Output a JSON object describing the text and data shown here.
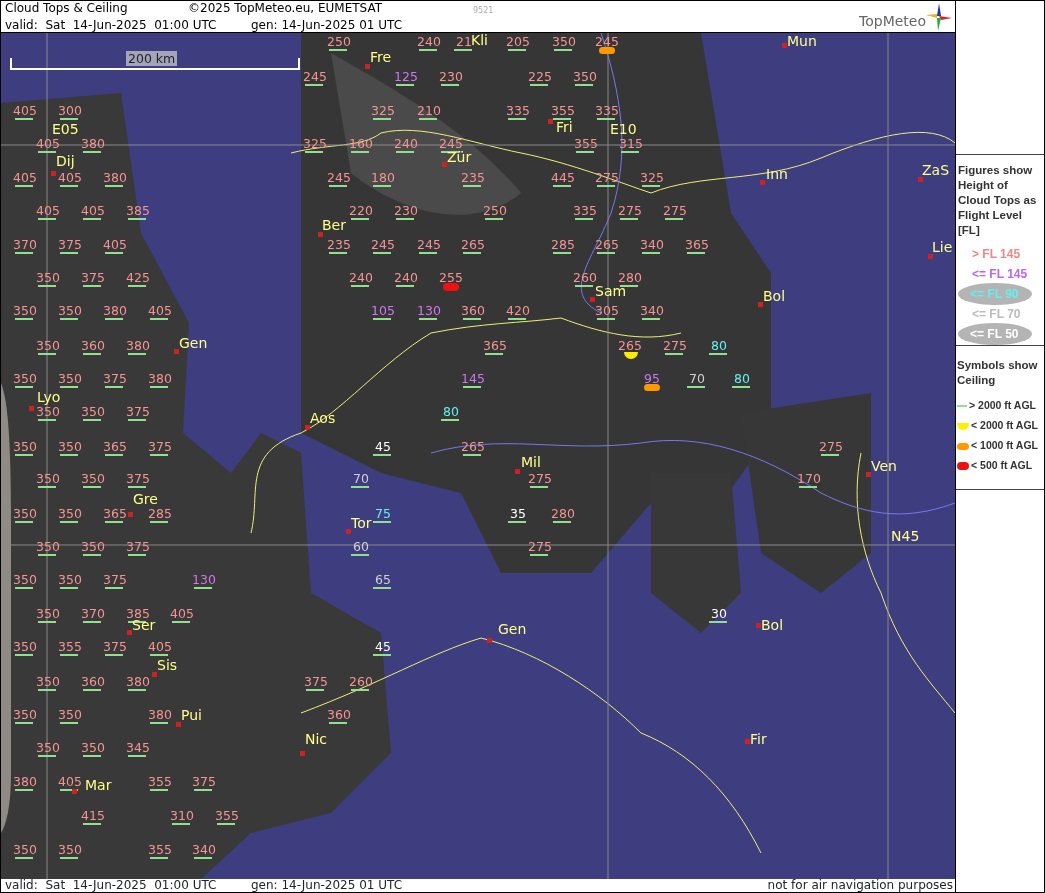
{
  "header": {
    "title": "Cloud Tops & Ceiling",
    "copyright": "©2025 TopMeteo.eu, EUMETSAT",
    "code": "9521",
    "valid": "valid:  Sat  14-Jun-2025  01:00 UTC",
    "generated": "gen: 14-Jun-2025 01 UTC",
    "logo": "TopMeteo"
  },
  "map": {
    "scale_bar": "200 km",
    "places": [
      {
        "name": "Kli",
        "kind": "label"
      },
      {
        "name": "Mun",
        "kind": "city"
      },
      {
        "name": "Fre",
        "kind": "city"
      },
      {
        "name": "E05",
        "kind": "label"
      },
      {
        "name": "Fri",
        "kind": "city"
      },
      {
        "name": "E10",
        "kind": "label"
      },
      {
        "name": "Dij",
        "kind": "city"
      },
      {
        "name": "Zür",
        "kind": "city"
      },
      {
        "name": "Inn",
        "kind": "city"
      },
      {
        "name": "ZaS",
        "kind": "city"
      },
      {
        "name": "Ber",
        "kind": "city"
      },
      {
        "name": "Lie",
        "kind": "city"
      },
      {
        "name": "Sam",
        "kind": "city"
      },
      {
        "name": "Bol",
        "kind": "city"
      },
      {
        "name": "Gen",
        "kind": "city"
      },
      {
        "name": "Lyo",
        "kind": "city"
      },
      {
        "name": "Aos",
        "kind": "city"
      },
      {
        "name": "Mil",
        "kind": "city"
      },
      {
        "name": "Ven",
        "kind": "city"
      },
      {
        "name": "Gre",
        "kind": "city"
      },
      {
        "name": "Tor",
        "kind": "city"
      },
      {
        "name": "N45",
        "kind": "label"
      },
      {
        "name": "Ser",
        "kind": "city"
      },
      {
        "name": "Gen",
        "kind": "city"
      },
      {
        "name": "Bol",
        "kind": "city"
      },
      {
        "name": "Sis",
        "kind": "city"
      },
      {
        "name": "Pui",
        "kind": "city"
      },
      {
        "name": "Nic",
        "kind": "city"
      },
      {
        "name": "Fir",
        "kind": "city"
      },
      {
        "name": "Mar",
        "kind": "city"
      }
    ],
    "figures": [
      {
        "value": "250",
        "color": "#f49494",
        "kind": "above_2000"
      },
      {
        "value": "240",
        "color": "#f49494",
        "kind": "above_2000"
      },
      {
        "value": "21",
        "color": "#f49494",
        "kind": "above_2000"
      },
      {
        "value": "205",
        "color": "#f49494",
        "kind": "above_2000"
      },
      {
        "value": "350",
        "color": "#f49494",
        "kind": "above_2000"
      },
      {
        "value": "245",
        "color": "#f49494",
        "kind": "below_1000"
      },
      {
        "value": "245",
        "color": "#f49494",
        "kind": "above_2000"
      },
      {
        "value": "125",
        "color": "#cc77ee",
        "kind": "above_2000"
      },
      {
        "value": "230",
        "color": "#f49494",
        "kind": "above_2000"
      },
      {
        "value": "225",
        "color": "#f49494",
        "kind": "above_2000"
      },
      {
        "value": "350",
        "color": "#f49494",
        "kind": "above_2000"
      },
      {
        "value": "405",
        "color": "#f49494",
        "kind": "above_2000"
      },
      {
        "value": "300",
        "color": "#f49494",
        "kind": "above_2000"
      },
      {
        "value": "325",
        "color": "#f49494",
        "kind": "above_2000"
      },
      {
        "value": "210",
        "color": "#f49494",
        "kind": "above_2000"
      },
      {
        "value": "335",
        "color": "#f49494",
        "kind": "above_2000"
      },
      {
        "value": "355",
        "color": "#f49494",
        "kind": "above_2000"
      },
      {
        "value": "335",
        "color": "#f49494",
        "kind": "above_2000"
      },
      {
        "value": "405",
        "color": "#f49494",
        "kind": "above_2000"
      },
      {
        "value": "380",
        "color": "#f49494",
        "kind": "above_2000"
      },
      {
        "value": "325",
        "color": "#f49494",
        "kind": "above_2000"
      },
      {
        "value": "160",
        "color": "#f49494",
        "kind": "above_2000"
      },
      {
        "value": "240",
        "color": "#f49494",
        "kind": "above_2000"
      },
      {
        "value": "245",
        "color": "#f49494",
        "kind": "above_2000"
      },
      {
        "value": "355",
        "color": "#f49494",
        "kind": "above_2000"
      },
      {
        "value": "315",
        "color": "#f49494",
        "kind": "above_2000"
      },
      {
        "value": "405",
        "color": "#f49494",
        "kind": "above_2000"
      },
      {
        "value": "405",
        "color": "#f49494",
        "kind": "above_2000"
      },
      {
        "value": "380",
        "color": "#f49494",
        "kind": "above_2000"
      },
      {
        "value": "245",
        "color": "#f49494",
        "kind": "above_2000"
      },
      {
        "value": "180",
        "color": "#f49494",
        "kind": "above_2000"
      },
      {
        "value": "235",
        "color": "#f49494",
        "kind": "above_2000"
      },
      {
        "value": "445",
        "color": "#f49494",
        "kind": "above_2000"
      },
      {
        "value": "275",
        "color": "#f49494",
        "kind": "above_2000"
      },
      {
        "value": "325",
        "color": "#f49494",
        "kind": "above_2000"
      },
      {
        "value": "405",
        "color": "#f49494",
        "kind": "above_2000"
      },
      {
        "value": "405",
        "color": "#f49494",
        "kind": "above_2000"
      },
      {
        "value": "385",
        "color": "#f49494",
        "kind": "above_2000"
      },
      {
        "value": "220",
        "color": "#f49494",
        "kind": "above_2000"
      },
      {
        "value": "230",
        "color": "#f49494",
        "kind": "above_2000"
      },
      {
        "value": "250",
        "color": "#f49494",
        "kind": "above_2000"
      },
      {
        "value": "335",
        "color": "#f49494",
        "kind": "above_2000"
      },
      {
        "value": "275",
        "color": "#f49494",
        "kind": "above_2000"
      },
      {
        "value": "275",
        "color": "#f49494",
        "kind": "above_2000"
      },
      {
        "value": "370",
        "color": "#f49494",
        "kind": "above_2000"
      },
      {
        "value": "375",
        "color": "#f49494",
        "kind": "above_2000"
      },
      {
        "value": "405",
        "color": "#f49494",
        "kind": "above_2000"
      },
      {
        "value": "235",
        "color": "#f49494",
        "kind": "above_2000"
      },
      {
        "value": "245",
        "color": "#f49494",
        "kind": "above_2000"
      },
      {
        "value": "245",
        "color": "#f49494",
        "kind": "above_2000"
      },
      {
        "value": "265",
        "color": "#f49494",
        "kind": "above_2000"
      },
      {
        "value": "285",
        "color": "#f49494",
        "kind": "above_2000"
      },
      {
        "value": "265",
        "color": "#f49494",
        "kind": "above_2000"
      },
      {
        "value": "340",
        "color": "#f49494",
        "kind": "above_2000"
      },
      {
        "value": "365",
        "color": "#f49494",
        "kind": "above_2000"
      },
      {
        "value": "350",
        "color": "#f49494",
        "kind": "above_2000"
      },
      {
        "value": "375",
        "color": "#f49494",
        "kind": "above_2000"
      },
      {
        "value": "425",
        "color": "#f49494",
        "kind": "above_2000"
      },
      {
        "value": "240",
        "color": "#f49494",
        "kind": "above_2000"
      },
      {
        "value": "240",
        "color": "#f49494",
        "kind": "above_2000"
      },
      {
        "value": "255",
        "color": "#f49494",
        "kind": "below_500"
      },
      {
        "value": "260",
        "color": "#f49494",
        "kind": "above_2000"
      },
      {
        "value": "280",
        "color": "#f49494",
        "kind": "above_2000"
      },
      {
        "value": "350",
        "color": "#f49494",
        "kind": "above_2000"
      },
      {
        "value": "350",
        "color": "#f49494",
        "kind": "above_2000"
      },
      {
        "value": "380",
        "color": "#f49494",
        "kind": "above_2000"
      },
      {
        "value": "405",
        "color": "#f49494",
        "kind": "above_2000"
      },
      {
        "value": "105",
        "color": "#cc77ee",
        "kind": "above_2000"
      },
      {
        "value": "130",
        "color": "#cc77ee",
        "kind": "above_2000"
      },
      {
        "value": "360",
        "color": "#f49494",
        "kind": "above_2000"
      },
      {
        "value": "420",
        "color": "#f49494",
        "kind": "above_2000"
      },
      {
        "value": "305",
        "color": "#f49494",
        "kind": "above_2000"
      },
      {
        "value": "340",
        "color": "#f49494",
        "kind": "above_2000"
      },
      {
        "value": "350",
        "color": "#f49494",
        "kind": "above_2000"
      },
      {
        "value": "360",
        "color": "#f49494",
        "kind": "above_2000"
      },
      {
        "value": "380",
        "color": "#f49494",
        "kind": "above_2000"
      },
      {
        "value": "365",
        "color": "#f49494",
        "kind": "above_2000"
      },
      {
        "value": "265",
        "color": "#f49494",
        "kind": "below_2000"
      },
      {
        "value": "275",
        "color": "#f49494",
        "kind": "above_2000"
      },
      {
        "value": "80",
        "color": "#66eeee",
        "kind": "above_2000"
      },
      {
        "value": "350",
        "color": "#f49494",
        "kind": "above_2000"
      },
      {
        "value": "350",
        "color": "#f49494",
        "kind": "above_2000"
      },
      {
        "value": "375",
        "color": "#f49494",
        "kind": "above_2000"
      },
      {
        "value": "380",
        "color": "#f49494",
        "kind": "above_2000"
      },
      {
        "value": "145",
        "color": "#cc77ee",
        "kind": "above_2000"
      },
      {
        "value": "95",
        "color": "#cc77ee",
        "kind": "below_1000"
      },
      {
        "value": "70",
        "color": "#d0d0d0",
        "kind": "above_2000"
      },
      {
        "value": "80",
        "color": "#66eeee",
        "kind": "above_2000"
      },
      {
        "value": "350",
        "color": "#f49494",
        "kind": "above_2000"
      },
      {
        "value": "350",
        "color": "#f49494",
        "kind": "above_2000"
      },
      {
        "value": "375",
        "color": "#f49494",
        "kind": "above_2000"
      },
      {
        "value": "80",
        "color": "#66eeee",
        "kind": "above_2000"
      },
      {
        "value": "350",
        "color": "#f49494",
        "kind": "above_2000"
      },
      {
        "value": "350",
        "color": "#f49494",
        "kind": "above_2000"
      },
      {
        "value": "365",
        "color": "#f49494",
        "kind": "above_2000"
      },
      {
        "value": "375",
        "color": "#f49494",
        "kind": "above_2000"
      },
      {
        "value": "45",
        "color": "#ffffff",
        "kind": "above_2000"
      },
      {
        "value": "265",
        "color": "#f49494",
        "kind": "above_2000"
      },
      {
        "value": "275",
        "color": "#f49494",
        "kind": "above_2000"
      },
      {
        "value": "350",
        "color": "#f49494",
        "kind": "above_2000"
      },
      {
        "value": "350",
        "color": "#f49494",
        "kind": "above_2000"
      },
      {
        "value": "375",
        "color": "#f49494",
        "kind": "above_2000"
      },
      {
        "value": "70",
        "color": "#d0d0d0",
        "kind": "above_2000"
      },
      {
        "value": "275",
        "color": "#f49494",
        "kind": "above_2000"
      },
      {
        "value": "170",
        "color": "#f49494",
        "kind": "above_2000"
      },
      {
        "value": "350",
        "color": "#f49494",
        "kind": "above_2000"
      },
      {
        "value": "350",
        "color": "#f49494",
        "kind": "above_2000"
      },
      {
        "value": "365",
        "color": "#f49494",
        "kind": "above_2000"
      },
      {
        "value": "285",
        "color": "#f49494",
        "kind": "above_2000"
      },
      {
        "value": "75",
        "color": "#66eeee",
        "kind": "above_2000"
      },
      {
        "value": "35",
        "color": "#ffffff",
        "kind": "above_2000"
      },
      {
        "value": "280",
        "color": "#f49494",
        "kind": "above_2000"
      },
      {
        "value": "350",
        "color": "#f49494",
        "kind": "above_2000"
      },
      {
        "value": "350",
        "color": "#f49494",
        "kind": "above_2000"
      },
      {
        "value": "375",
        "color": "#f49494",
        "kind": "above_2000"
      },
      {
        "value": "60",
        "color": "#d0d0d0",
        "kind": "above_2000"
      },
      {
        "value": "275",
        "color": "#f49494",
        "kind": "above_2000"
      },
      {
        "value": "350",
        "color": "#f49494",
        "kind": "above_2000"
      },
      {
        "value": "350",
        "color": "#f49494",
        "kind": "above_2000"
      },
      {
        "value": "375",
        "color": "#f49494",
        "kind": "above_2000"
      },
      {
        "value": "130",
        "color": "#cc77ee",
        "kind": "above_2000"
      },
      {
        "value": "65",
        "color": "#d0d0d0",
        "kind": "above_2000"
      },
      {
        "value": "350",
        "color": "#f49494",
        "kind": "above_2000"
      },
      {
        "value": "370",
        "color": "#f49494",
        "kind": "above_2000"
      },
      {
        "value": "385",
        "color": "#f49494",
        "kind": "above_2000"
      },
      {
        "value": "405",
        "color": "#f49494",
        "kind": "above_2000"
      },
      {
        "value": "30",
        "color": "#ffffff",
        "kind": "above_2000"
      },
      {
        "value": "350",
        "color": "#f49494",
        "kind": "above_2000"
      },
      {
        "value": "355",
        "color": "#f49494",
        "kind": "above_2000"
      },
      {
        "value": "375",
        "color": "#f49494",
        "kind": "above_2000"
      },
      {
        "value": "405",
        "color": "#f49494",
        "kind": "above_2000"
      },
      {
        "value": "45",
        "color": "#ffffff",
        "kind": "above_2000"
      },
      {
        "value": "350",
        "color": "#f49494",
        "kind": "above_2000"
      },
      {
        "value": "360",
        "color": "#f49494",
        "kind": "above_2000"
      },
      {
        "value": "380",
        "color": "#f49494",
        "kind": "above_2000"
      },
      {
        "value": "375",
        "color": "#f49494",
        "kind": "above_2000"
      },
      {
        "value": "260",
        "color": "#f49494",
        "kind": "above_2000"
      },
      {
        "value": "350",
        "color": "#f49494",
        "kind": "above_2000"
      },
      {
        "value": "350",
        "color": "#f49494",
        "kind": "above_2000"
      },
      {
        "value": "380",
        "color": "#f49494",
        "kind": "above_2000"
      },
      {
        "value": "360",
        "color": "#f49494",
        "kind": "above_2000"
      },
      {
        "value": "350",
        "color": "#f49494",
        "kind": "above_2000"
      },
      {
        "value": "350",
        "color": "#f49494",
        "kind": "above_2000"
      },
      {
        "value": "345",
        "color": "#f49494",
        "kind": "above_2000"
      },
      {
        "value": "380",
        "color": "#f49494",
        "kind": "above_2000"
      },
      {
        "value": "405",
        "color": "#f49494",
        "kind": "above_2000"
      },
      {
        "value": "355",
        "color": "#f49494",
        "kind": "above_2000"
      },
      {
        "value": "375",
        "color": "#f49494",
        "kind": "above_2000"
      },
      {
        "value": "415",
        "color": "#f49494",
        "kind": "above_2000"
      },
      {
        "value": "310",
        "color": "#f49494",
        "kind": "above_2000"
      },
      {
        "value": "355",
        "color": "#f49494",
        "kind": "above_2000"
      },
      {
        "value": "350",
        "color": "#f49494",
        "kind": "above_2000"
      },
      {
        "value": "350",
        "color": "#f49494",
        "kind": "above_2000"
      },
      {
        "value": "355",
        "color": "#f49494",
        "kind": "above_2000"
      },
      {
        "value": "340",
        "color": "#f49494",
        "kind": "above_2000"
      }
    ]
  },
  "legend": {
    "tops_title": "Figures show Height of Cloud Tops as Flight Level  [FL]",
    "tops": [
      {
        "label": "> FL 145",
        "color": "#ee8888",
        "kind": "plain"
      },
      {
        "label": "<= FL 145",
        "color": "#bb66ee",
        "kind": "oval_none"
      },
      {
        "label": "<= FL 90",
        "color": "#66eeee",
        "kind": "oval"
      },
      {
        "label": "<= FL 70",
        "color": "#bbbbbb",
        "kind": "plain"
      },
      {
        "label": "<= FL 50",
        "color": "#ffffff",
        "kind": "oval"
      }
    ],
    "ceiling_title": "Symbols show Ceiling",
    "ceiling": [
      {
        "label": "> 2000 ft AGL",
        "kind": "above_2000"
      },
      {
        "label": "< 2000 ft AGL",
        "kind": "below_2000"
      },
      {
        "label": "< 1000 ft AGL",
        "kind": "below_1000"
      },
      {
        "label": "< 500 ft AGL",
        "kind": "below_500"
      }
    ]
  },
  "footer": {
    "valid": "valid:  Sat  14-Jun-2025  01:00 UTC",
    "generated": "gen: 14-Jun-2025 01 UTC",
    "disclaimer": "not for air navigation purposes"
  }
}
